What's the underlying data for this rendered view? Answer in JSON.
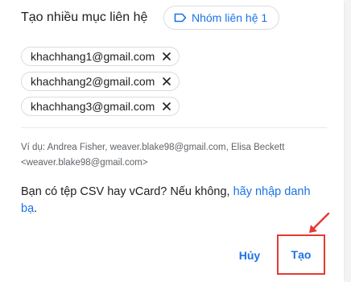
{
  "dialog": {
    "title": "Tạo nhiều mục liên hệ",
    "group_chip_label": "Nhóm liên hệ 1",
    "chips": [
      "khachhang1@gmail.com",
      "khachhang2@gmail.com",
      "khachhang3@gmail.com"
    ],
    "example_text": "Ví dụ: Andrea Fisher, weaver.blake98@gmail.com, Elisa Beckett <weaver.blake98@gmail.com>",
    "csv_prefix": "Bạn có tệp CSV hay vCard? Nếu không, ",
    "csv_link": "hãy nhập danh bạ",
    "csv_suffix": ".",
    "cancel_label": "Hủy",
    "create_label": "Tạo"
  },
  "colors": {
    "accent": "#1a73e8",
    "highlight": "#e53935",
    "text": "#202124",
    "muted": "#5f6368",
    "border": "#dadce0"
  },
  "icons": {
    "group": "label-icon",
    "remove": "close-icon",
    "annotation": "arrow-icon"
  }
}
